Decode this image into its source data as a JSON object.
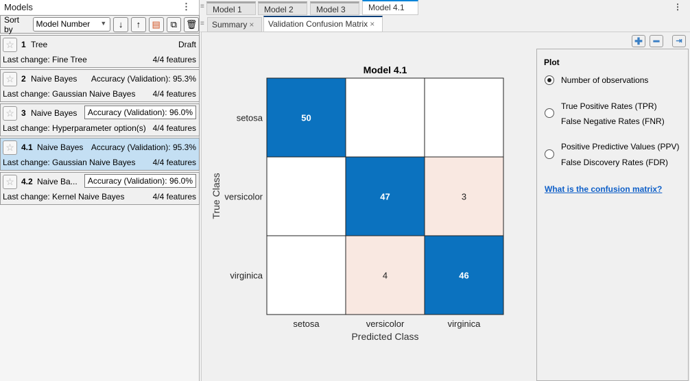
{
  "models_panel": {
    "title": "Models",
    "sort_label": "Sort by",
    "sort_value": "Model Number",
    "items": [
      {
        "num": "1",
        "name": "Tree",
        "status": "Draft",
        "change": "Last change: Fine Tree",
        "features": "4/4 features",
        "boxed": false,
        "selected": false
      },
      {
        "num": "2",
        "name": "Naive Bayes",
        "status": "Accuracy (Validation): 95.3%",
        "change": "Last change: Gaussian Naive Bayes",
        "features": "4/4 features",
        "boxed": false,
        "selected": false
      },
      {
        "num": "3",
        "name": "Naive Bayes",
        "status": "Accuracy (Validation): 96.0%",
        "change": "Last change: Hyperparameter option(s)",
        "features": "4/4 features",
        "boxed": true,
        "selected": false
      },
      {
        "num": "4.1",
        "name": "Naive Bayes",
        "status": "Accuracy (Validation): 95.3%",
        "change": "Last change: Gaussian Naive Bayes",
        "features": "4/4 features",
        "boxed": false,
        "selected": true
      },
      {
        "num": "4.2",
        "name": "Naive Ba...",
        "status": "Accuracy (Validation): 96.0%",
        "change": "Last change: Kernel Naive Bayes",
        "features": "4/4 features",
        "boxed": true,
        "selected": false
      }
    ]
  },
  "tabs": [
    "Model 1",
    "Model 2",
    "Model 3",
    "Model 4.1"
  ],
  "subtabs": [
    "Summary",
    "Validation Confusion Matrix"
  ],
  "plot_panel": {
    "title": "Plot",
    "options": [
      "Number of observations",
      "True Positive Rates (TPR)",
      "False Negative Rates (FNR)",
      "Positive Predictive Values (PPV)",
      "False Discovery Rates (FDR)"
    ],
    "selected": 0,
    "link": "What is the confusion matrix?"
  },
  "chart_data": {
    "type": "heatmap",
    "title": "Model 4.1",
    "xlabel": "Predicted Class",
    "ylabel": "True Class",
    "classes": [
      "setosa",
      "versicolor",
      "virginica"
    ],
    "values": [
      [
        50,
        0,
        0
      ],
      [
        0,
        47,
        3
      ],
      [
        0,
        4,
        46
      ]
    ],
    "colors": {
      "diagonal": "#0b72bf",
      "off_diagonal": "#f9e8e1",
      "empty": "#ffffff"
    }
  }
}
